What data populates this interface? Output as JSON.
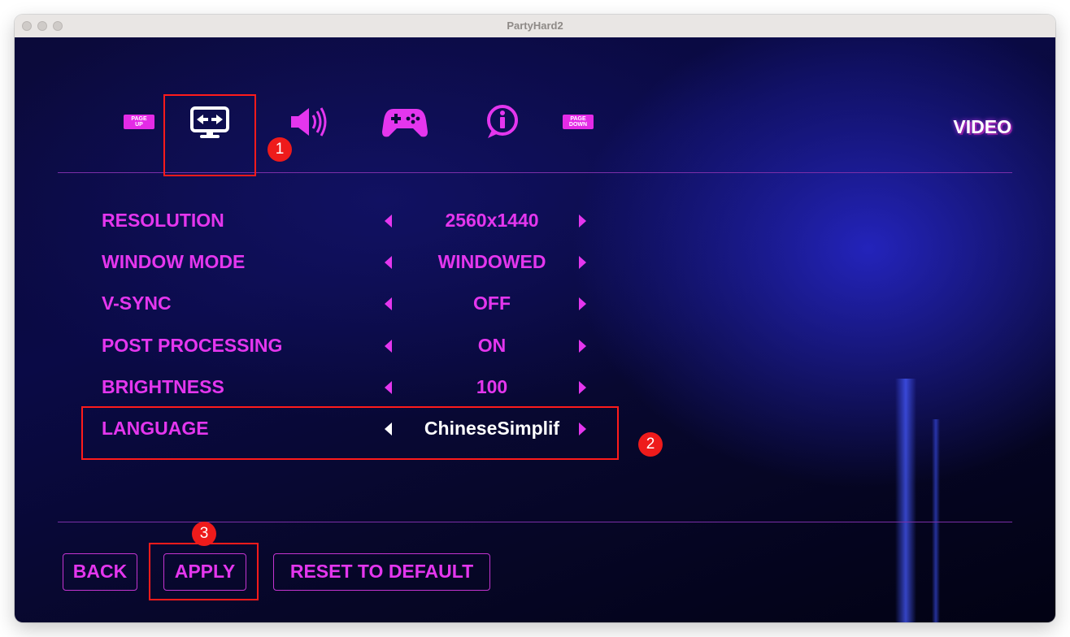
{
  "window": {
    "title": "PartyHard2"
  },
  "tabs": {
    "page_up": [
      "PAGE",
      "UP"
    ],
    "page_down": [
      "PAGE",
      "DOWN"
    ],
    "items": [
      {
        "name": "video",
        "icon": "monitor-icon"
      },
      {
        "name": "audio",
        "icon": "speaker-icon"
      },
      {
        "name": "controls",
        "icon": "gamepad-icon"
      },
      {
        "name": "info",
        "icon": "info-icon"
      }
    ]
  },
  "screen_title": "VIDEO",
  "settings": [
    {
      "label": "RESOLUTION",
      "value": "2560x1440"
    },
    {
      "label": "WINDOW MODE",
      "value": "WINDOWED"
    },
    {
      "label": "V-SYNC",
      "value": "OFF"
    },
    {
      "label": "POST PROCESSING",
      "value": "ON"
    },
    {
      "label": "BRIGHTNESS",
      "value": "100"
    },
    {
      "label": "LANGUAGE",
      "value": "ChineseSimplif"
    }
  ],
  "buttons": {
    "back": "BACK",
    "apply": "APPLY",
    "reset": "RESET TO DEFAULT"
  },
  "annotations": [
    "1",
    "2",
    "3"
  ],
  "colors": {
    "accent": "#e436ee",
    "annotation": "#ff1b1b",
    "highlight_value": "#ffffff"
  }
}
